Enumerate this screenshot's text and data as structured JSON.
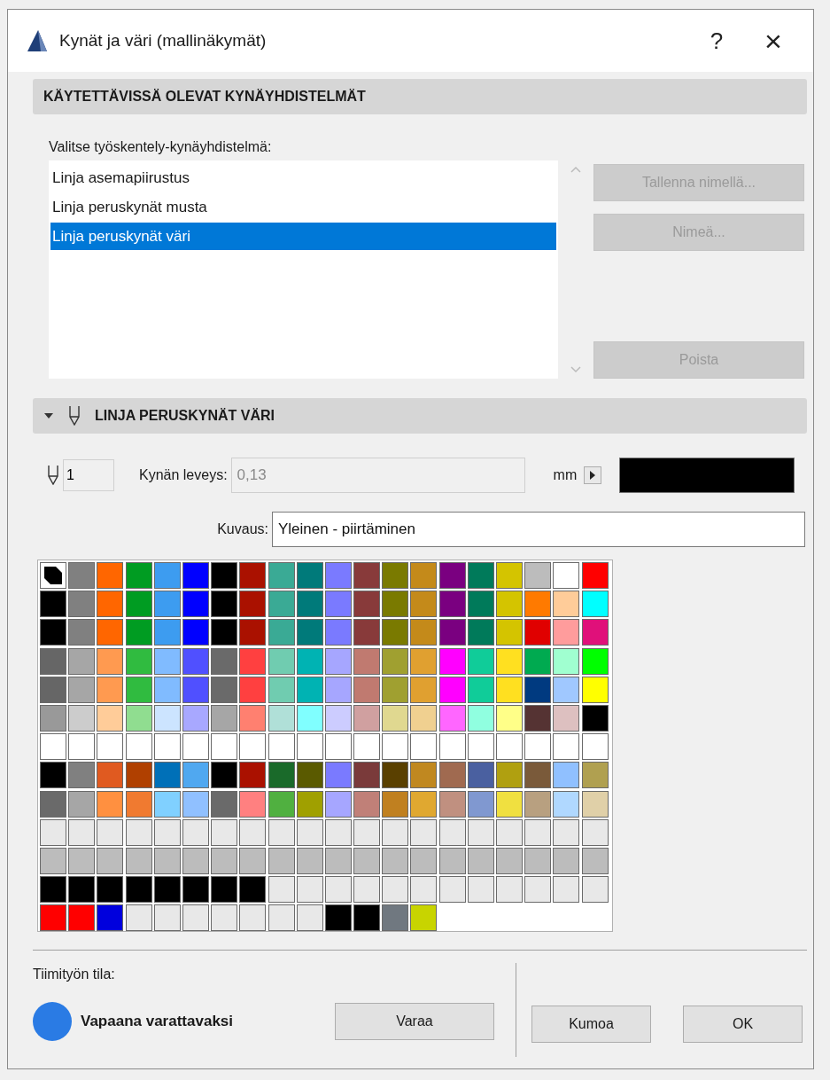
{
  "window": {
    "title": "Kynät ja väri (mallinäkymät)",
    "help_button": "?",
    "close_button": "×"
  },
  "sets_section": {
    "title": "KÄYTETTÄVISSÄ OLEVAT KYNÄYHDISTELMÄT",
    "list_label": "Valitse työskentely-kynäyhdistelmä:",
    "items": [
      {
        "label": "Linja asemapiirustus",
        "selected": false
      },
      {
        "label": "Linja peruskynät musta",
        "selected": false
      },
      {
        "label": "Linja peruskynät väri",
        "selected": true
      }
    ],
    "buttons": [
      {
        "label": "Tallenna nimellä...",
        "disabled": true
      },
      {
        "label": "Nimeä...",
        "disabled": true
      },
      {
        "label": "Poista",
        "disabled": true
      }
    ]
  },
  "pen_section": {
    "title": "LINJA PERUSKYNÄT VÄRI",
    "expanded": true,
    "pen_number": "1",
    "width_label": "Kynän leveys:",
    "width_value": "0,13",
    "unit": "mm",
    "description_label": "Kuvaus:",
    "description_value": "Yleinen - piirtäminen",
    "palette": [
      [
        {
          "color": "#000000",
          "selected": true
        },
        {
          "color": "#808080",
          "selected": false
        },
        {
          "color": "#ff6600",
          "selected": false
        },
        {
          "color": "#009c22",
          "selected": false
        },
        {
          "color": "#3d9cf0",
          "selected": false
        },
        {
          "color": "#0000ff",
          "selected": false
        },
        {
          "color": "#000000",
          "selected": false
        },
        {
          "color": "#aa1100",
          "selected": false
        },
        {
          "color": "#3aaa95",
          "selected": false
        },
        {
          "color": "#007a7a",
          "selected": false
        },
        {
          "color": "#7a7aff",
          "selected": false
        },
        {
          "color": "#883a3a",
          "selected": false
        },
        {
          "color": "#7a7a00",
          "selected": false
        },
        {
          "color": "#c48a1a",
          "selected": false
        },
        {
          "color": "#7a0080",
          "selected": false
        },
        {
          "color": "#007a5a",
          "selected": false
        },
        {
          "color": "#d4c400",
          "selected": false
        },
        {
          "color": "#bcbcbc",
          "selected": false
        },
        {
          "color": "#ffffff",
          "selected": false
        },
        {
          "color": "#ff0000",
          "selected": false
        }
      ],
      [
        {
          "color": "#000000",
          "selected": false
        },
        {
          "color": "#808080",
          "selected": false
        },
        {
          "color": "#ff6600",
          "selected": false
        },
        {
          "color": "#009c22",
          "selected": false
        },
        {
          "color": "#3d9cf0",
          "selected": false
        },
        {
          "color": "#0000ff",
          "selected": false
        },
        {
          "color": "#000000",
          "selected": false
        },
        {
          "color": "#aa1100",
          "selected": false
        },
        {
          "color": "#3aaa95",
          "selected": false
        },
        {
          "color": "#007a7a",
          "selected": false
        },
        {
          "color": "#7a7aff",
          "selected": false
        },
        {
          "color": "#883a3a",
          "selected": false
        },
        {
          "color": "#7a7a00",
          "selected": false
        },
        {
          "color": "#c48a1a",
          "selected": false
        },
        {
          "color": "#7a0080",
          "selected": false
        },
        {
          "color": "#007a5a",
          "selected": false
        },
        {
          "color": "#d4c400",
          "selected": false
        },
        {
          "color": "#ff7a00",
          "selected": false
        },
        {
          "color": "#ffcc99",
          "selected": false
        },
        {
          "color": "#00ffff",
          "selected": false
        }
      ],
      [
        {
          "color": "#000000",
          "selected": false
        },
        {
          "color": "#808080",
          "selected": false
        },
        {
          "color": "#ff6600",
          "selected": false
        },
        {
          "color": "#009c22",
          "selected": false
        },
        {
          "color": "#3d9cf0",
          "selected": false
        },
        {
          "color": "#0000ff",
          "selected": false
        },
        {
          "color": "#000000",
          "selected": false
        },
        {
          "color": "#aa1100",
          "selected": false
        },
        {
          "color": "#3aaa95",
          "selected": false
        },
        {
          "color": "#007a7a",
          "selected": false
        },
        {
          "color": "#7a7aff",
          "selected": false
        },
        {
          "color": "#883a3a",
          "selected": false
        },
        {
          "color": "#7a7a00",
          "selected": false
        },
        {
          "color": "#c48a1a",
          "selected": false
        },
        {
          "color": "#7a0080",
          "selected": false
        },
        {
          "color": "#007a5a",
          "selected": false
        },
        {
          "color": "#d4c400",
          "selected": false
        },
        {
          "color": "#e00000",
          "selected": false
        },
        {
          "color": "#ff9c9c",
          "selected": false
        },
        {
          "color": "#e0107a",
          "selected": false
        }
      ],
      [
        {
          "color": "#666666",
          "selected": false
        },
        {
          "color": "#a6a6a6",
          "selected": false
        },
        {
          "color": "#ff9a50",
          "selected": false
        },
        {
          "color": "#30bb40",
          "selected": false
        },
        {
          "color": "#80bbff",
          "selected": false
        },
        {
          "color": "#5050ff",
          "selected": false
        },
        {
          "color": "#6a6a6a",
          "selected": false
        },
        {
          "color": "#ff4040",
          "selected": false
        },
        {
          "color": "#70ccb0",
          "selected": false
        },
        {
          "color": "#00b3b3",
          "selected": false
        },
        {
          "color": "#a6a6ff",
          "selected": false
        },
        {
          "color": "#c07a70",
          "selected": false
        },
        {
          "color": "#a0a030",
          "selected": false
        },
        {
          "color": "#e0a030",
          "selected": false
        },
        {
          "color": "#ff00ff",
          "selected": false
        },
        {
          "color": "#10cc99",
          "selected": false
        },
        {
          "color": "#ffe020",
          "selected": false
        },
        {
          "color": "#00aa50",
          "selected": false
        },
        {
          "color": "#a0ffd0",
          "selected": false
        },
        {
          "color": "#00ff00",
          "selected": false
        }
      ],
      [
        {
          "color": "#666666",
          "selected": false
        },
        {
          "color": "#a6a6a6",
          "selected": false
        },
        {
          "color": "#ff9a50",
          "selected": false
        },
        {
          "color": "#30bb40",
          "selected": false
        },
        {
          "color": "#80bbff",
          "selected": false
        },
        {
          "color": "#5050ff",
          "selected": false
        },
        {
          "color": "#6a6a6a",
          "selected": false
        },
        {
          "color": "#ff4040",
          "selected": false
        },
        {
          "color": "#70ccb0",
          "selected": false
        },
        {
          "color": "#00b3b3",
          "selected": false
        },
        {
          "color": "#a6a6ff",
          "selected": false
        },
        {
          "color": "#c07a70",
          "selected": false
        },
        {
          "color": "#a0a030",
          "selected": false
        },
        {
          "color": "#e0a030",
          "selected": false
        },
        {
          "color": "#ff00ff",
          "selected": false
        },
        {
          "color": "#10cc99",
          "selected": false
        },
        {
          "color": "#ffe020",
          "selected": false
        },
        {
          "color": "#003a80",
          "selected": false
        },
        {
          "color": "#a0c8ff",
          "selected": false
        },
        {
          "color": "#ffff00",
          "selected": false
        }
      ],
      [
        {
          "color": "#999999",
          "selected": false
        },
        {
          "color": "#cccccc",
          "selected": false
        },
        {
          "color": "#ffcc99",
          "selected": false
        },
        {
          "color": "#90dd90",
          "selected": false
        },
        {
          "color": "#cce4ff",
          "selected": false
        },
        {
          "color": "#a8a8ff",
          "selected": false
        },
        {
          "color": "#a6a6a6",
          "selected": false
        },
        {
          "color": "#ff8070",
          "selected": false
        },
        {
          "color": "#b0e0d8",
          "selected": false
        },
        {
          "color": "#80ffff",
          "selected": false
        },
        {
          "color": "#ccccff",
          "selected": false
        },
        {
          "color": "#d0a0a0",
          "selected": false
        },
        {
          "color": "#e0d890",
          "selected": false
        },
        {
          "color": "#f0d090",
          "selected": false
        },
        {
          "color": "#ff66ff",
          "selected": false
        },
        {
          "color": "#90ffe0",
          "selected": false
        },
        {
          "color": "#ffff88",
          "selected": false
        },
        {
          "color": "#553333",
          "selected": false
        },
        {
          "color": "#ddc0c0",
          "selected": false
        },
        {
          "color": "#000000",
          "selected": false
        }
      ],
      [
        {
          "color": "#ffffff",
          "selected": false
        },
        {
          "color": "#ffffff",
          "selected": false
        },
        {
          "color": "#ffffff",
          "selected": false
        },
        {
          "color": "#ffffff",
          "selected": false
        },
        {
          "color": "#ffffff",
          "selected": false
        },
        {
          "color": "#ffffff",
          "selected": false
        },
        {
          "color": "#ffffff",
          "selected": false
        },
        {
          "color": "#ffffff",
          "selected": false
        },
        {
          "color": "#ffffff",
          "selected": false
        },
        {
          "color": "#ffffff",
          "selected": false
        },
        {
          "color": "#ffffff",
          "selected": false
        },
        {
          "color": "#ffffff",
          "selected": false
        },
        {
          "color": "#ffffff",
          "selected": false
        },
        {
          "color": "#ffffff",
          "selected": false
        },
        {
          "color": "#ffffff",
          "selected": false
        },
        {
          "color": "#ffffff",
          "selected": false
        },
        {
          "color": "#ffffff",
          "selected": false
        },
        {
          "color": "#ffffff",
          "selected": false
        },
        {
          "color": "#ffffff",
          "selected": false
        },
        {
          "color": "#ffffff",
          "selected": false
        }
      ],
      [
        {
          "color": "#000000",
          "selected": false
        },
        {
          "color": "#808080",
          "selected": false
        },
        {
          "color": "#e05a20",
          "selected": false
        },
        {
          "color": "#b04000",
          "selected": false
        },
        {
          "color": "#0070b8",
          "selected": false
        },
        {
          "color": "#50a8f0",
          "selected": false
        },
        {
          "color": "#000000",
          "selected": false
        },
        {
          "color": "#aa1100",
          "selected": false
        },
        {
          "color": "#1a6a2a",
          "selected": false
        },
        {
          "color": "#5a5a00",
          "selected": false
        },
        {
          "color": "#7a7aff",
          "selected": false
        },
        {
          "color": "#7a3a3a",
          "selected": false
        },
        {
          "color": "#5a4000",
          "selected": false
        },
        {
          "color": "#c08820",
          "selected": false
        },
        {
          "color": "#a06a50",
          "selected": false
        },
        {
          "color": "#4a60a0",
          "selected": false
        },
        {
          "color": "#b0a010",
          "selected": false
        },
        {
          "color": "#7a5a3a",
          "selected": false
        },
        {
          "color": "#90c0ff",
          "selected": false
        },
        {
          "color": "#b0a050",
          "selected": false
        }
      ],
      [
        {
          "color": "#6a6a6a",
          "selected": false
        },
        {
          "color": "#a6a6a6",
          "selected": false
        },
        {
          "color": "#ff9040",
          "selected": false
        },
        {
          "color": "#f07a30",
          "selected": false
        },
        {
          "color": "#80d0ff",
          "selected": false
        },
        {
          "color": "#90c0ff",
          "selected": false
        },
        {
          "color": "#6a6a6a",
          "selected": false
        },
        {
          "color": "#ff8080",
          "selected": false
        },
        {
          "color": "#50b040",
          "selected": false
        },
        {
          "color": "#a0a000",
          "selected": false
        },
        {
          "color": "#a6a6ff",
          "selected": false
        },
        {
          "color": "#c08078",
          "selected": false
        },
        {
          "color": "#c08020",
          "selected": false
        },
        {
          "color": "#e0a830",
          "selected": false
        },
        {
          "color": "#c09080",
          "selected": false
        },
        {
          "color": "#8098d0",
          "selected": false
        },
        {
          "color": "#f0e040",
          "selected": false
        },
        {
          "color": "#b8a080",
          "selected": false
        },
        {
          "color": "#b0d8ff",
          "selected": false
        },
        {
          "color": "#e0d0a8",
          "selected": false
        }
      ],
      [
        {
          "color": "#e8e8e8",
          "selected": false
        },
        {
          "color": "#e8e8e8",
          "selected": false
        },
        {
          "color": "#e8e8e8",
          "selected": false
        },
        {
          "color": "#e8e8e8",
          "selected": false
        },
        {
          "color": "#e8e8e8",
          "selected": false
        },
        {
          "color": "#e8e8e8",
          "selected": false
        },
        {
          "color": "#e8e8e8",
          "selected": false
        },
        {
          "color": "#e8e8e8",
          "selected": false
        },
        {
          "color": "#e8e8e8",
          "selected": false
        },
        {
          "color": "#e8e8e8",
          "selected": false
        },
        {
          "color": "#e8e8e8",
          "selected": false
        },
        {
          "color": "#e8e8e8",
          "selected": false
        },
        {
          "color": "#e8e8e8",
          "selected": false
        },
        {
          "color": "#e8e8e8",
          "selected": false
        },
        {
          "color": "#e8e8e8",
          "selected": false
        },
        {
          "color": "#e8e8e8",
          "selected": false
        },
        {
          "color": "#e8e8e8",
          "selected": false
        },
        {
          "color": "#e8e8e8",
          "selected": false
        },
        {
          "color": "#e8e8e8",
          "selected": false
        },
        {
          "color": "#e8e8e8",
          "selected": false
        }
      ],
      [
        {
          "color": "#bcbcbc",
          "selected": false
        },
        {
          "color": "#bcbcbc",
          "selected": false
        },
        {
          "color": "#bcbcbc",
          "selected": false
        },
        {
          "color": "#bcbcbc",
          "selected": false
        },
        {
          "color": "#bcbcbc",
          "selected": false
        },
        {
          "color": "#bcbcbc",
          "selected": false
        },
        {
          "color": "#bcbcbc",
          "selected": false
        },
        {
          "color": "#bcbcbc",
          "selected": false
        },
        {
          "color": "#bcbcbc",
          "selected": false
        },
        {
          "color": "#bcbcbc",
          "selected": false
        },
        {
          "color": "#bcbcbc",
          "selected": false
        },
        {
          "color": "#bcbcbc",
          "selected": false
        },
        {
          "color": "#bcbcbc",
          "selected": false
        },
        {
          "color": "#bcbcbc",
          "selected": false
        },
        {
          "color": "#bcbcbc",
          "selected": false
        },
        {
          "color": "#bcbcbc",
          "selected": false
        },
        {
          "color": "#bcbcbc",
          "selected": false
        },
        {
          "color": "#bcbcbc",
          "selected": false
        },
        {
          "color": "#bcbcbc",
          "selected": false
        },
        {
          "color": "#bcbcbc",
          "selected": false
        }
      ],
      [
        {
          "color": "#000000",
          "selected": false
        },
        {
          "color": "#000000",
          "selected": false
        },
        {
          "color": "#000000",
          "selected": false
        },
        {
          "color": "#000000",
          "selected": false
        },
        {
          "color": "#000000",
          "selected": false
        },
        {
          "color": "#000000",
          "selected": false
        },
        {
          "color": "#000000",
          "selected": false
        },
        {
          "color": "#000000",
          "selected": false
        },
        {
          "color": "#e8e8e8",
          "selected": false
        },
        {
          "color": "#e8e8e8",
          "selected": false
        },
        {
          "color": "#e8e8e8",
          "selected": false
        },
        {
          "color": "#e8e8e8",
          "selected": false
        },
        {
          "color": "#e8e8e8",
          "selected": false
        },
        {
          "color": "#e8e8e8",
          "selected": false
        },
        {
          "color": "#e8e8e8",
          "selected": false
        },
        {
          "color": "#e8e8e8",
          "selected": false
        },
        {
          "color": "#e8e8e8",
          "selected": false
        },
        {
          "color": "#e8e8e8",
          "selected": false
        },
        {
          "color": "#e8e8e8",
          "selected": false
        },
        {
          "color": "#e8e8e8",
          "selected": false
        }
      ],
      [
        {
          "color": "#ff0000",
          "selected": false
        },
        {
          "color": "#ff0000",
          "selected": false
        },
        {
          "color": "#0000dd",
          "selected": false
        },
        {
          "color": "#e8e8e8",
          "selected": false
        },
        {
          "color": "#e8e8e8",
          "selected": false
        },
        {
          "color": "#e8e8e8",
          "selected": false
        },
        {
          "color": "#e8e8e8",
          "selected": false
        },
        {
          "color": "#e8e8e8",
          "selected": false
        },
        {
          "color": "#e8e8e8",
          "selected": false
        },
        {
          "color": "#e8e8e8",
          "selected": false
        },
        {
          "color": "#000000",
          "selected": false
        },
        {
          "color": "#000000",
          "selected": false
        },
        {
          "color": "#707880",
          "selected": false
        },
        {
          "color": "#c8d400",
          "selected": false
        }
      ]
    ]
  },
  "footer": {
    "team_label": "Tiimityön tila:",
    "status": "Vapaana varattavaksi",
    "buttons": [
      {
        "label": "Varaa",
        "disabled": false
      },
      {
        "label": "Kumoa",
        "disabled": false
      },
      {
        "label": "OK",
        "disabled": false
      }
    ]
  }
}
